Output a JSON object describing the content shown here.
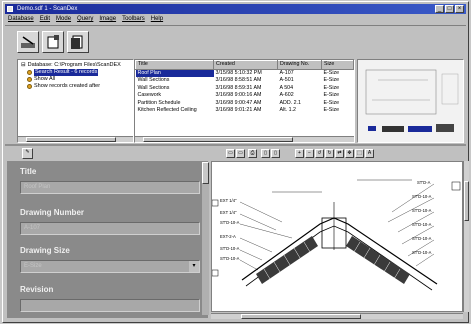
{
  "window": {
    "title": "Demo.sdf 1 - ScanDex"
  },
  "menu": [
    "Database",
    "Edit",
    "Mode",
    "Query",
    "Image",
    "Toolbars",
    "Help"
  ],
  "tree": {
    "root": "Database: C:\\Program Files\\ScanDEX",
    "items": [
      "Search Result - 6 records",
      "Show All",
      "Show records created after"
    ]
  },
  "grid": {
    "columns": [
      "Title",
      "Created",
      "Drawing No.",
      "Size"
    ],
    "rows": [
      [
        "Roof Plan",
        "3/15/98 5:10:32 PM",
        "A-107",
        "E-Size"
      ],
      [
        "Wall Sections",
        "3/16/98 8:58:51 AM",
        "A-501",
        "E-Size"
      ],
      [
        "Wall Sections",
        "3/16/98 8:59:31 AM",
        "A 504",
        "E-Size"
      ],
      [
        "Casework",
        "3/16/98 9:00:16 AM",
        "A-602",
        "E-Size"
      ],
      [
        "Partition Schedule",
        "3/16/98 9:00:47 AM",
        "ADD. 2.1",
        "E-Size"
      ],
      [
        "Kitchen Reflected Ceiling",
        "3/16/98 9:01:21 AM",
        "Alt. 1.2",
        "E-Size"
      ]
    ]
  },
  "form": {
    "title_label": "Title",
    "title_value": "Roof Plan",
    "drawing_number_label": "Drawing Number",
    "drawing_number_value": "A-107",
    "drawing_size_label": "Drawing Size",
    "drawing_size_value": "E-Size",
    "revision_label": "Revision",
    "revision_value": ""
  },
  "drawing_labels": {
    "left": [
      "EXT 1/4\"",
      "EXT 1/4\"",
      "ST'D-10-A",
      "EXT-2-A",
      "ST'D-10-A",
      "ST'D-10-A"
    ],
    "right": [
      "ST'D-A",
      "ST'D-10-A",
      "ST'D-10-A",
      "ST'D-10-A",
      "ST'D-10-A",
      "ST'D-10-A"
    ]
  },
  "colors": {
    "selection": "#1a2a9a",
    "title_gradient_end": "#3a5ac8",
    "panel": "#8a8a8a"
  }
}
